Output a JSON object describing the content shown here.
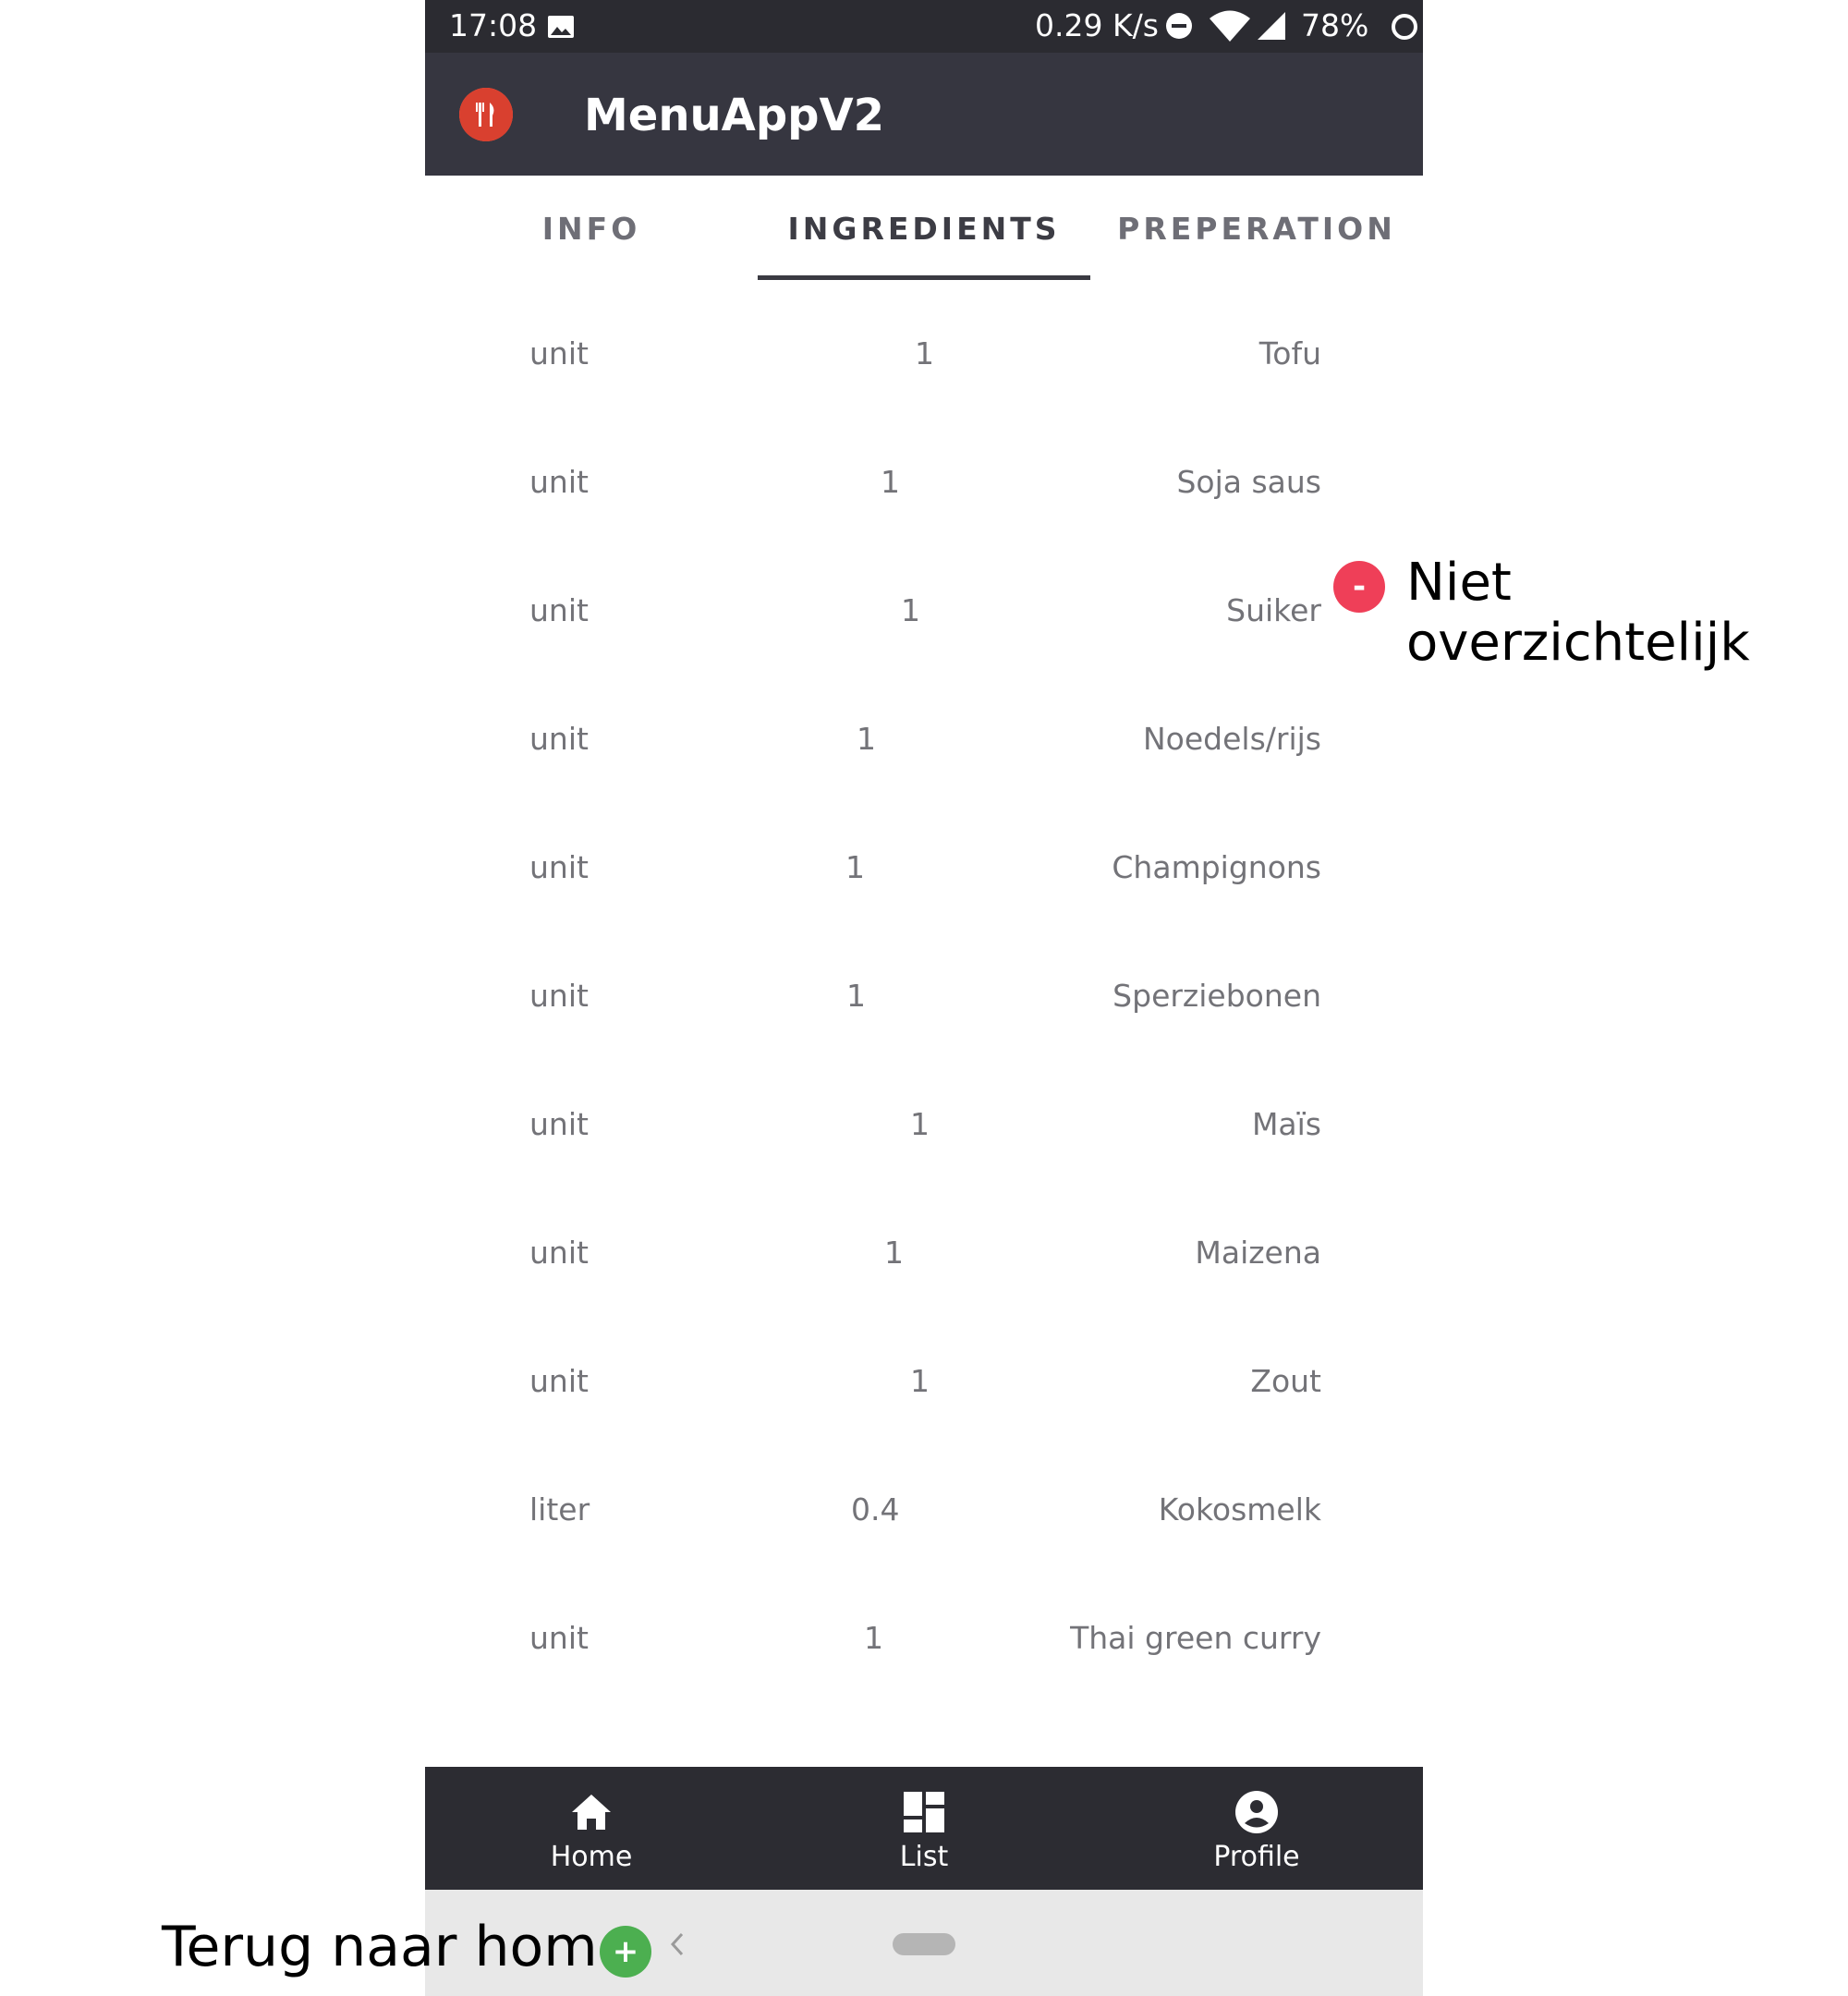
{
  "status_bar": {
    "time": "17:08",
    "net_speed": "0.29 K/s",
    "battery": "78%"
  },
  "app_bar": {
    "title": "MenuAppV2",
    "logo_icon": "fork-knife-icon"
  },
  "tabs": [
    {
      "label": "INFO",
      "active": false
    },
    {
      "label": "INGREDIENTS",
      "active": true
    },
    {
      "label": "PREPERATION",
      "active": false
    }
  ],
  "ingredients": [
    {
      "unit": "unit",
      "amount": "1",
      "name": "Tofu"
    },
    {
      "unit": "unit",
      "amount": "1",
      "name": "Soja saus"
    },
    {
      "unit": "unit",
      "amount": "1",
      "name": "Suiker"
    },
    {
      "unit": "unit",
      "amount": "1",
      "name": "Noedels/rijs"
    },
    {
      "unit": "unit",
      "amount": "1",
      "name": "Champignons"
    },
    {
      "unit": "unit",
      "amount": "1",
      "name": "Sperziebonen"
    },
    {
      "unit": "unit",
      "amount": "1",
      "name": "Maïs"
    },
    {
      "unit": "unit",
      "amount": "1",
      "name": "Maizena"
    },
    {
      "unit": "unit",
      "amount": "1",
      "name": "Zout"
    },
    {
      "unit": "liter",
      "amount": "0.4",
      "name": "Kokosmelk"
    },
    {
      "unit": "unit",
      "amount": "1",
      "name": "Thai green curry"
    }
  ],
  "bottom_nav": [
    {
      "label": "Home",
      "icon": "home-icon"
    },
    {
      "label": "List",
      "icon": "dashboard-icon"
    },
    {
      "label": "Profile",
      "icon": "account-circle-icon"
    }
  ],
  "annotations": {
    "negative": {
      "symbol": "-",
      "text": "Niet overzichtelijk"
    },
    "positive": {
      "symbol": "+",
      "text": "Terug naar home"
    }
  },
  "colors": {
    "status_bar": "#2b2b31",
    "app_bar": "#363640",
    "bottom_nav": "#2c2c32",
    "negative_badge": "#ef3f58",
    "positive_badge": "#4caf50"
  }
}
